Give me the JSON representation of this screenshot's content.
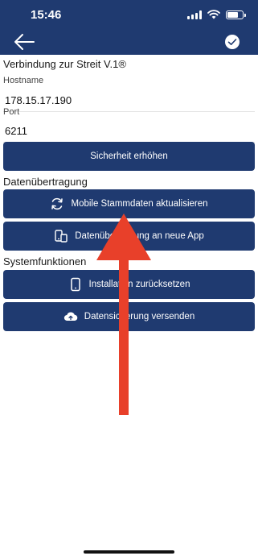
{
  "status_bar": {
    "time": "15:46",
    "icons": [
      "signal-icon",
      "wifi-icon",
      "battery-icon"
    ]
  },
  "header": {
    "back_icon": "arrow-left-icon",
    "confirm_icon": "check-circle-icon",
    "background": "#1f3a70"
  },
  "connection": {
    "title": "Verbindung zur Streit V.1®",
    "hostname_label": "Hostname",
    "hostname_value": "178.15.17.190",
    "port_label": "Port",
    "port_value": "6211",
    "security_button": "Sicherheit erhöhen"
  },
  "transfer": {
    "title": "Datenübertragung",
    "refresh_button": "Mobile Stammdaten aktualisieren",
    "refresh_icon": "refresh-icon",
    "migrate_button": "Datenübertragung an neue App",
    "migrate_icon": "devices-icon"
  },
  "system": {
    "title": "Systemfunktionen",
    "reset_button": "Installation zurücksetzen",
    "reset_icon": "phone-icon",
    "backup_button": "Datensicherung versenden",
    "backup_icon": "cloud-upload-icon"
  },
  "overlay": {
    "annotation": "red-arrow-up",
    "color": "#e8402a"
  },
  "colors": {
    "primary": "#1f3a70",
    "button_text": "#ffffff"
  }
}
